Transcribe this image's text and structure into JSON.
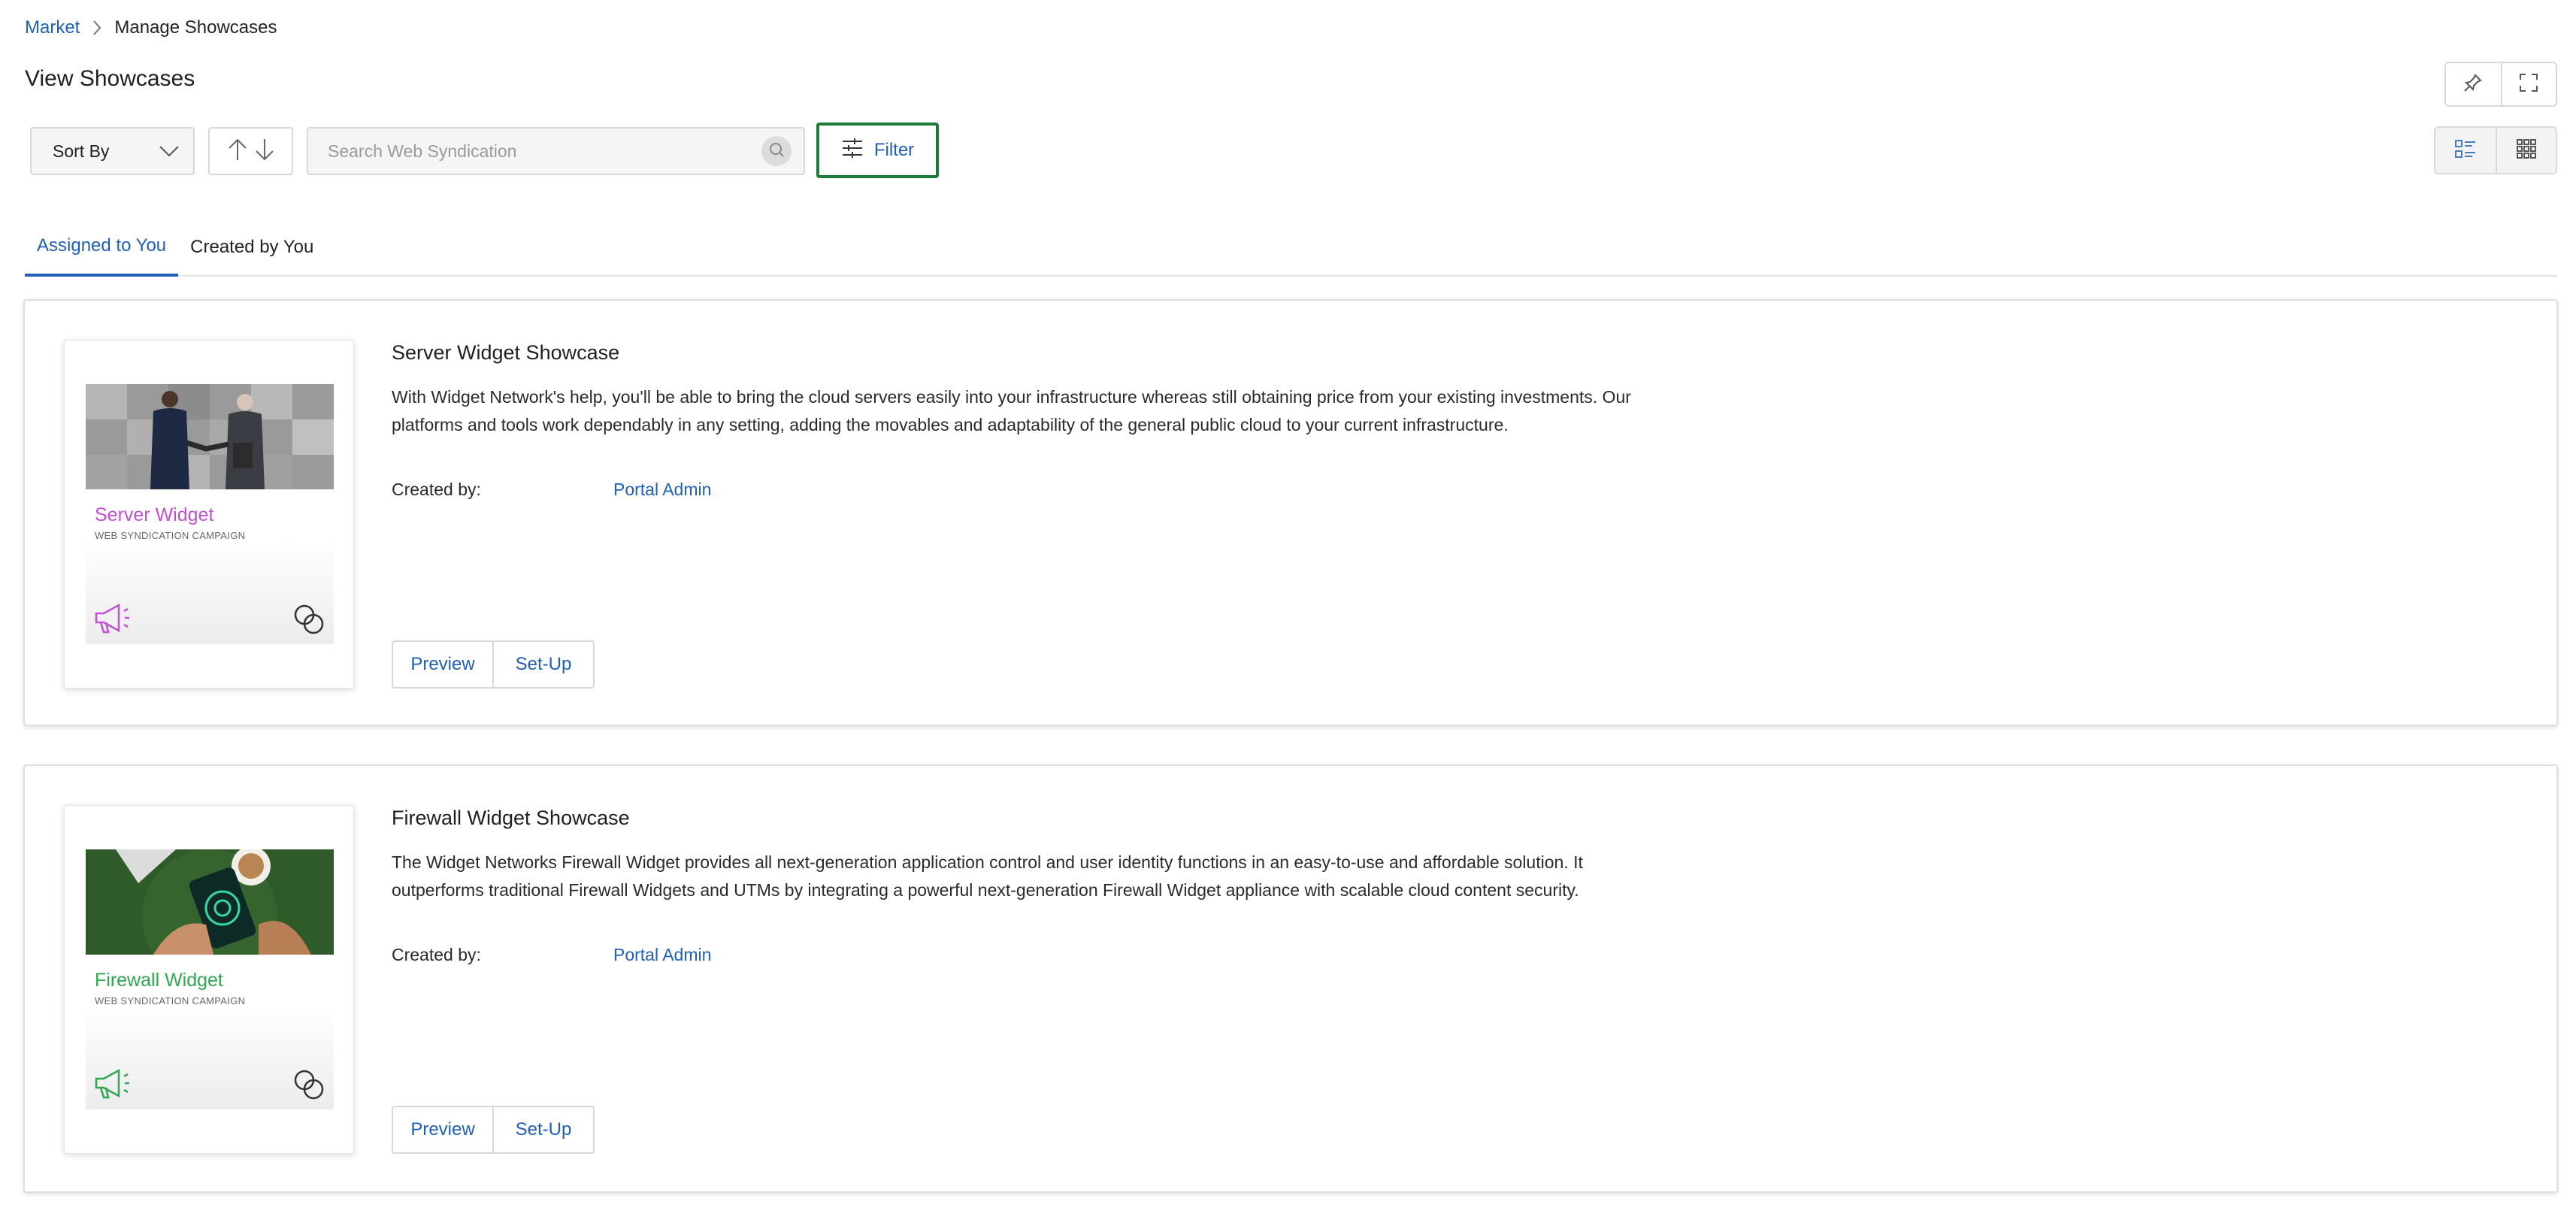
{
  "breadcrumb": {
    "parent": "Market",
    "current": "Manage Showcases"
  },
  "page": {
    "title": "View Showcases"
  },
  "toolbar": {
    "sort_label": "Sort By",
    "search_placeholder": "Search Web Syndication",
    "filter_label": "Filter"
  },
  "tabs": [
    {
      "label": "Assigned to You",
      "active": true
    },
    {
      "label": "Created by You",
      "active": false
    }
  ],
  "showcases": [
    {
      "title": "Server Widget Showcase",
      "description": "With Widget Network's help, you'll be able to bring the cloud servers easily into your infrastructure whereas still obtaining price from your existing investments. Our platforms and tools work dependably in any setting, adding the movables and adaptability of the general public cloud to your current infrastructure.",
      "created_by_label": "Created by:",
      "created_by": "Portal Admin",
      "thumb_title": "Server Widget",
      "thumb_subtitle": "WEB SYNDICATION CAMPAIGN",
      "accent_color": "#c24fd6",
      "preview_label": "Preview",
      "setup_label": "Set-Up"
    },
    {
      "title": "Firewall Widget Showcase",
      "description": "The Widget Networks Firewall Widget provides all next-generation application control and user identity functions in an easy-to-use and affordable solution. It outperforms traditional Firewall Widgets and UTMs by integrating a powerful next-generation Firewall Widget appliance with scalable cloud content security.",
      "created_by_label": "Created by:",
      "created_by": "Portal Admin",
      "thumb_title": "Firewall Widget",
      "thumb_subtitle": "WEB SYNDICATION CAMPAIGN",
      "accent_color": "#2fa84f",
      "preview_label": "Preview",
      "setup_label": "Set-Up"
    }
  ],
  "colors": {
    "link": "#1f5fb8",
    "filter_outline": "#1e7c3a"
  }
}
